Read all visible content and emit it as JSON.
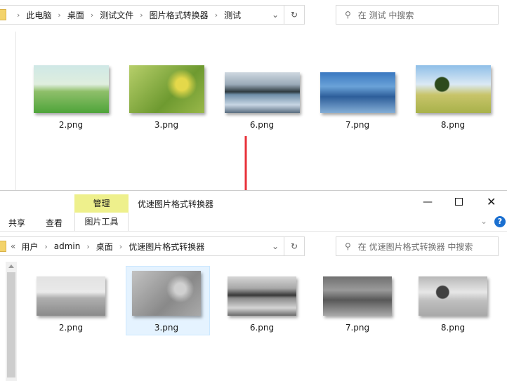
{
  "top": {
    "path": [
      "此电脑",
      "桌面",
      "测试文件",
      "图片格式转换器",
      "测试"
    ],
    "search_placeholder": "在 测试 中搜索",
    "files": [
      "2.png",
      "3.png",
      "6.png",
      "7.png",
      "8.png"
    ]
  },
  "bottom": {
    "tab_manage": "管理",
    "window_title": "优速图片格式转换器",
    "ribbon": [
      "共享",
      "查看",
      "图片工具"
    ],
    "path": [
      "用户",
      "admin",
      "桌面",
      "优速图片格式转换器"
    ],
    "search_placeholder": "在 优速图片格式转换器 中搜索",
    "files": [
      "2.png",
      "3.png",
      "6.png",
      "7.png",
      "8.png"
    ],
    "selected": "3.png"
  },
  "colors": {
    "arrow": "#e8313a",
    "tab": "#eef08c",
    "selected": "#e5f3ff"
  }
}
